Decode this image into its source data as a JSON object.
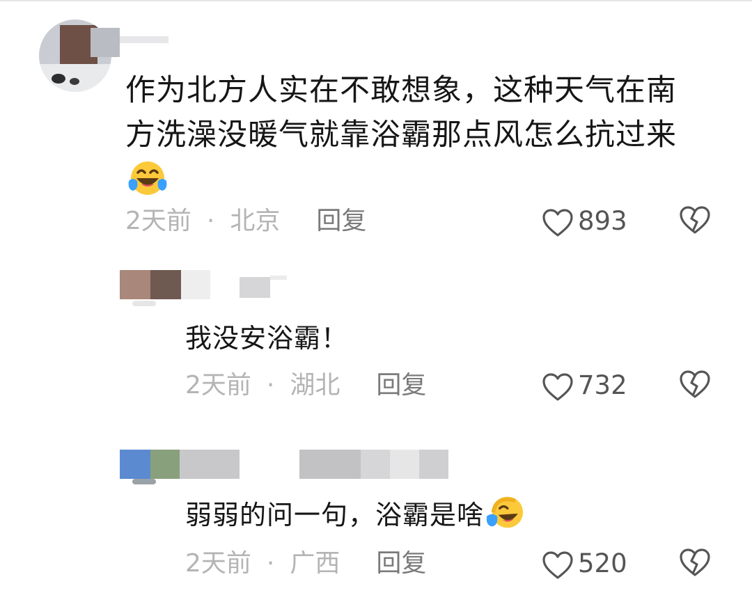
{
  "comments": [
    {
      "text_line1": "作为北方人实在不敢想象，这种天气在南",
      "text_line2": "方洗澡没暖气就靠浴霸那点风怎么抗过来",
      "emoji": "laughing-tears-emoji",
      "time": "2天前",
      "location": "北京",
      "reply_label": "回复",
      "likes": "893"
    },
    {
      "text": "我没安浴霸！",
      "time": "2天前",
      "location": "湖北",
      "reply_label": "回复",
      "likes": "732"
    },
    {
      "text": "弱弱的问一句，浴霸是啥",
      "emoji": "laughing-tears-emoji",
      "time": "2天前",
      "location": "广西",
      "reply_label": "回复",
      "likes": "520"
    }
  ],
  "separator": "·",
  "colors": {
    "text": "#161616",
    "meta": "#b4b4b4",
    "reply": "#7a7a7a",
    "icon": "#555555",
    "emoji_face": "#fcc93b",
    "emoji_tear": "#3aa0ff"
  }
}
